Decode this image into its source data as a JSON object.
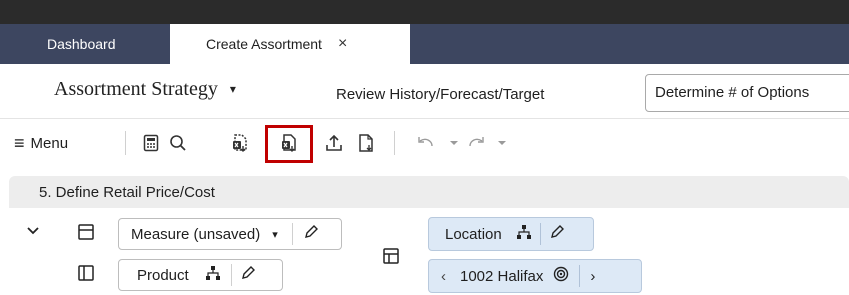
{
  "tabs": [
    {
      "label": "Dashboard"
    },
    {
      "label": "Create Assortment",
      "close": "×"
    }
  ],
  "header": {
    "title": "Assortment Strategy",
    "title_caret": "▾",
    "step_review": "Review History/Forecast/Target",
    "step_determine": "Determine # of Options"
  },
  "toolbar": {
    "menu_icon": "≡",
    "menu_label": "Menu"
  },
  "panel": {
    "title": "5. Define Retail Price/Cost",
    "measure_label": "Measure (unsaved)",
    "measure_caret": "▾",
    "product_label": "Product",
    "location_label": "Location",
    "location_value": "1002 Halifax",
    "prev": "‹",
    "next": "›"
  },
  "colors": {
    "tab_bar": "#3d4660",
    "top_bar": "#2b2b2b",
    "highlight": "#c00000",
    "location_chip": "#dde9f6",
    "panel_header": "#ededed"
  },
  "icons": [
    "menu-icon",
    "calculator-icon",
    "search-icon",
    "export-icon",
    "export-highlighted-icon",
    "upload-icon",
    "save-icon",
    "undo-icon",
    "redo-icon",
    "hierarchy-icon",
    "pencil-icon",
    "target-icon",
    "chevron-down-icon",
    "row-layout-icon",
    "column-layout-icon",
    "pivot-icon"
  ]
}
